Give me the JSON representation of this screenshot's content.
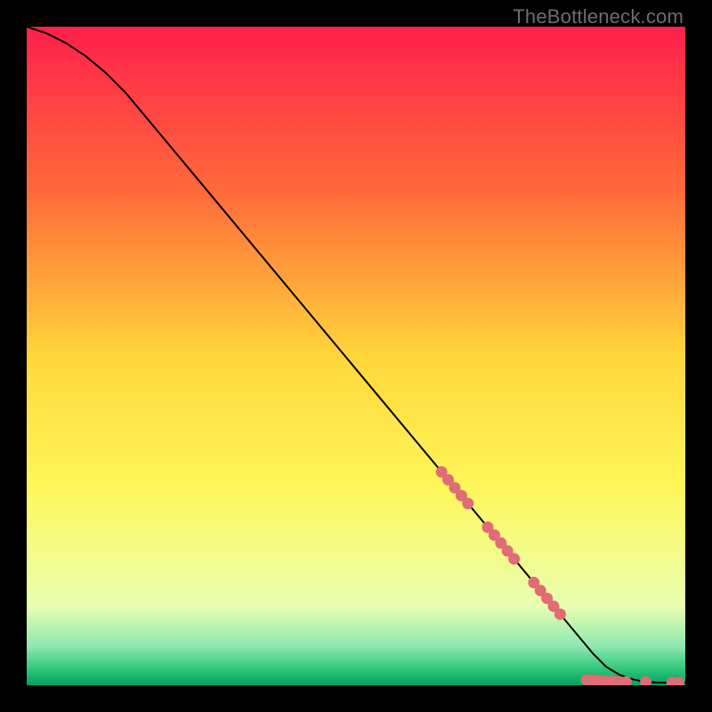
{
  "watermark": "TheBottleneck.com",
  "chart_data": {
    "type": "line",
    "title": "",
    "xlabel": "",
    "ylabel": "",
    "xlim": [
      0,
      100
    ],
    "ylim": [
      0,
      100
    ],
    "grid": false,
    "background_gradient": {
      "stops": [
        {
          "offset": 0.0,
          "color": "#ff1f4b"
        },
        {
          "offset": 0.25,
          "color": "#ff6a3a"
        },
        {
          "offset": 0.5,
          "color": "#ffd63a"
        },
        {
          "offset": 0.7,
          "color": "#fff65a"
        },
        {
          "offset": 0.88,
          "color": "#e8ffb0"
        },
        {
          "offset": 0.94,
          "color": "#8fe8b0"
        },
        {
          "offset": 0.975,
          "color": "#30c87a"
        },
        {
          "offset": 1.0,
          "color": "#00a060"
        }
      ]
    },
    "series": [
      {
        "name": "curve",
        "color": "#000000",
        "x": [
          0,
          3,
          6,
          9,
          12,
          15,
          20,
          30,
          40,
          50,
          60,
          70,
          80,
          82,
          84,
          86,
          88,
          90,
          92,
          94,
          96,
          98,
          100
        ],
        "y": [
          100,
          99,
          97.5,
          95.5,
          93,
          90,
          84,
          72,
          60,
          48,
          36,
          24,
          12,
          9.6,
          7.2,
          4.8,
          2.8,
          1.6,
          0.9,
          0.5,
          0.4,
          0.4,
          0.4
        ]
      }
    ],
    "markers": {
      "name": "highlighted-points",
      "color": "#e06c75",
      "radius": 6.5,
      "points": [
        {
          "x": 63,
          "y": 32.4
        },
        {
          "x": 64,
          "y": 31.2
        },
        {
          "x": 65,
          "y": 30.0
        },
        {
          "x": 66,
          "y": 28.8
        },
        {
          "x": 67,
          "y": 27.6
        },
        {
          "x": 70,
          "y": 24.0
        },
        {
          "x": 71,
          "y": 22.8
        },
        {
          "x": 72,
          "y": 21.6
        },
        {
          "x": 73,
          "y": 20.4
        },
        {
          "x": 74,
          "y": 19.2
        },
        {
          "x": 77,
          "y": 15.6
        },
        {
          "x": 78,
          "y": 14.4
        },
        {
          "x": 79,
          "y": 13.2
        },
        {
          "x": 80,
          "y": 12.0
        },
        {
          "x": 81,
          "y": 10.8
        },
        {
          "x": 85,
          "y": 0.8
        },
        {
          "x": 86,
          "y": 0.8
        },
        {
          "x": 87,
          "y": 0.7
        },
        {
          "x": 88,
          "y": 0.6
        },
        {
          "x": 89,
          "y": 0.6
        },
        {
          "x": 90,
          "y": 0.5
        },
        {
          "x": 91,
          "y": 0.5
        },
        {
          "x": 94,
          "y": 0.5
        },
        {
          "x": 98,
          "y": 0.4
        },
        {
          "x": 99,
          "y": 0.4
        }
      ]
    }
  }
}
